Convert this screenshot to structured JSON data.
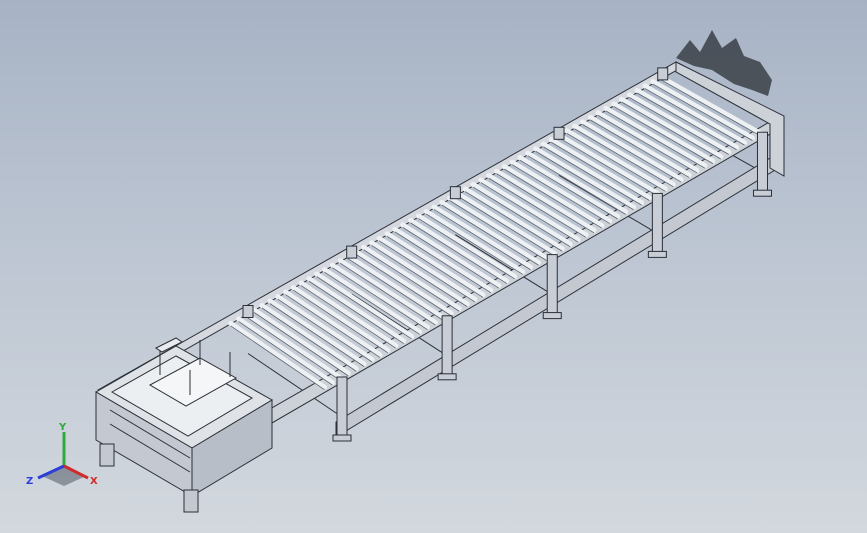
{
  "viewport": {
    "background_top": "#a7b3c5",
    "background_bottom": "#d3d8de"
  },
  "model": {
    "roller_color": "#eef1f4",
    "frame_color": "#c9ced6",
    "edge_color": "#2b2f36",
    "shadow_color": "#3a3f47",
    "sections": 4
  },
  "triad": {
    "x_label": "X",
    "y_label": "Y",
    "z_label": "Z",
    "x_color": "#d22a2a",
    "y_color": "#2faa3a",
    "z_color": "#2b3fd6"
  }
}
